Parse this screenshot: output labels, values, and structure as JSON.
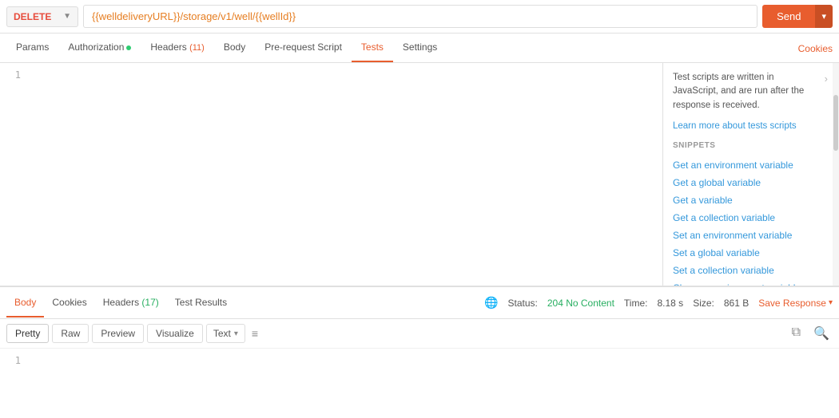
{
  "method": {
    "value": "DELETE",
    "color": "#e74c3c"
  },
  "url": "{{welldeliveryURL}}/storage/v1/well/{{wellId}}",
  "send_button": "Send",
  "nav": {
    "tabs": [
      {
        "label": "Params",
        "active": false,
        "badge": null,
        "dot": false
      },
      {
        "label": "Authorization",
        "active": false,
        "badge": null,
        "dot": true
      },
      {
        "label": "Headers",
        "active": false,
        "badge": "(11)",
        "dot": false
      },
      {
        "label": "Body",
        "active": false,
        "badge": null,
        "dot": false
      },
      {
        "label": "Pre-request Script",
        "active": false,
        "badge": null,
        "dot": false
      },
      {
        "label": "Tests",
        "active": true,
        "badge": null,
        "dot": false
      },
      {
        "label": "Settings",
        "active": false,
        "badge": null,
        "dot": false
      }
    ],
    "cookies_link": "Cookies"
  },
  "snippets_panel": {
    "info_text": "Test scripts are written in JavaScript, and are run after the response is received.",
    "learn_link": "Learn more about tests scripts",
    "label": "SNIPPETS",
    "items": [
      "Get an environment variable",
      "Get a global variable",
      "Get a variable",
      "Get a collection variable",
      "Set an environment variable",
      "Set a global variable",
      "Set a collection variable",
      "Clear an environment variable"
    ]
  },
  "bottom_tabs": {
    "tabs": [
      {
        "label": "Body",
        "active": true
      },
      {
        "label": "Cookies",
        "active": false
      },
      {
        "label": "Headers",
        "active": false,
        "badge": "(17)",
        "badge_color": "green"
      },
      {
        "label": "Test Results",
        "active": false
      }
    ],
    "status": {
      "label": "Status:",
      "value": "204 No Content",
      "time_label": "Time:",
      "time_value": "8.18 s",
      "size_label": "Size:",
      "size_value": "861 B"
    },
    "save_response": "Save Response"
  },
  "response_toolbar": {
    "formats": [
      "Pretty",
      "Raw",
      "Preview",
      "Visualize"
    ],
    "active_format": "Pretty",
    "text_option": "Text"
  },
  "editor_line": "1",
  "response_line": "1"
}
